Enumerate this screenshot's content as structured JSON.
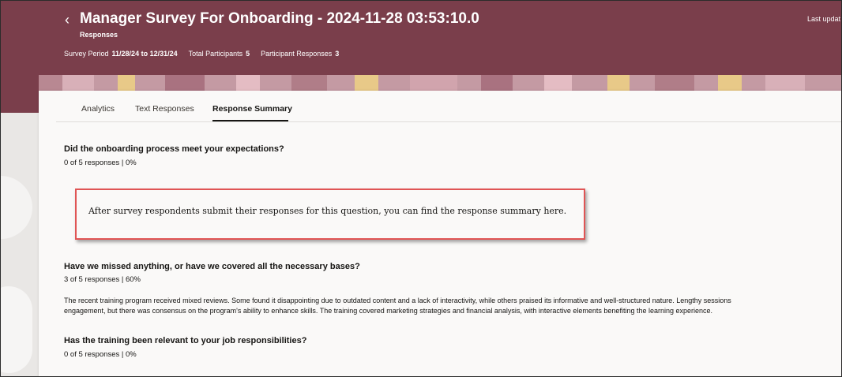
{
  "header": {
    "title": "Manager Survey For Onboarding - 2024-11-28 03:53:10.0",
    "subtitle": "Responses",
    "last_updated_label": "Last updat",
    "meta": {
      "survey_period_label": "Survey Period",
      "survey_period_value": "11/28/24 to 12/31/24",
      "total_participants_label": "Total Participants",
      "total_participants_value": "5",
      "participant_responses_label": "Participant Responses",
      "participant_responses_value": "3"
    },
    "colors": {
      "background": "#7a3e4b",
      "text": "#ffffff"
    }
  },
  "tabs": [
    {
      "label": "Analytics",
      "active": false
    },
    {
      "label": "Text Responses",
      "active": false
    },
    {
      "label": "Response Summary",
      "active": true
    }
  ],
  "questions": [
    {
      "title": "Did the onboarding process meet your expectations?",
      "count": "0 of 5 responses | 0%",
      "notice": "After survey respondents submit their responses for this question, you can find the response summary here."
    },
    {
      "title": "Have we missed anything, or have we covered all the necessary bases?",
      "count": "3 of 5 responses | 60%",
      "answer_lines": [
        "The recent training program received mixed reviews. Some found it disappointing due to outdated content and a lack of interactivity, while others praised its informative and well-structured nature. Lengthy sessions",
        "engagement, but there was consensus on the program's ability to enhance skills. The training covered marketing strategies and financial analysis, with interactive elements benefiting the learning experience."
      ]
    },
    {
      "title": "Has the training been relevant to your job responsibilities?",
      "count": "0 of 5 responses | 0%"
    }
  ],
  "highlight_color": "#e05555"
}
